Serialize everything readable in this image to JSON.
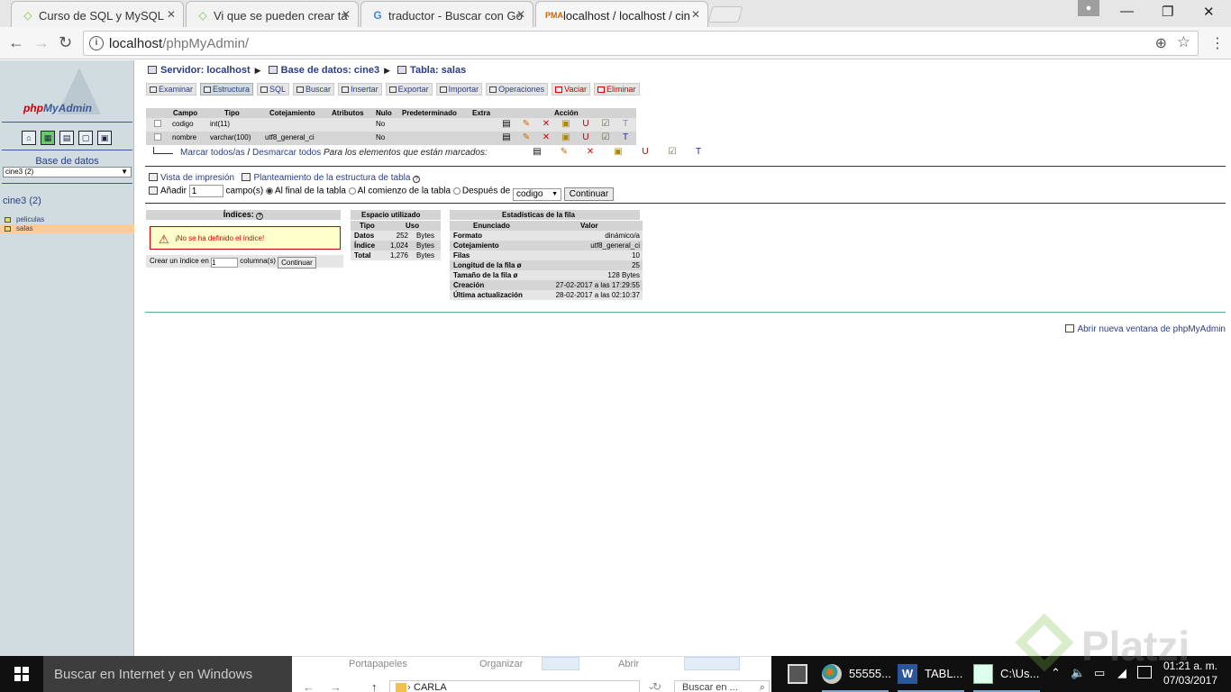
{
  "browser": {
    "tabs": [
      {
        "title": "Curso de SQL y MySQL",
        "icon": "platzi-icon",
        "active": false
      },
      {
        "title": "Vi que se pueden crear ta",
        "icon": "platzi-icon",
        "active": false
      },
      {
        "title": "traductor - Buscar con Go",
        "icon": "google-icon",
        "active": false
      },
      {
        "title": "localhost / localhost / cin",
        "icon": "pma-icon",
        "active": true
      }
    ],
    "url_host": "localhost",
    "url_path": "/phpMyAdmin/"
  },
  "sidebar": {
    "logo_php": "php",
    "logo_myadmin": "MyAdmin",
    "db_label": "Base de datos",
    "db_select": "cine3 (2)",
    "db_name": "cine3 (2)",
    "tables": [
      {
        "name": "peliculas",
        "selected": false
      },
      {
        "name": "salas",
        "selected": true
      }
    ]
  },
  "breadcrumb": {
    "server": "Servidor: localhost",
    "database": "Base de datos: cine3",
    "table": "Tabla: salas"
  },
  "tabs": [
    {
      "label": "Examinar",
      "active": false,
      "red": false
    },
    {
      "label": "Estructura",
      "active": true,
      "red": false
    },
    {
      "label": "SQL",
      "active": false,
      "red": false
    },
    {
      "label": "Buscar",
      "active": false,
      "red": false
    },
    {
      "label": "Insertar",
      "active": false,
      "red": false
    },
    {
      "label": "Exportar",
      "active": false,
      "red": false
    },
    {
      "label": "Importar",
      "active": false,
      "red": false
    },
    {
      "label": "Operaciones",
      "active": false,
      "red": false
    },
    {
      "label": "Vaciar",
      "active": false,
      "red": true
    },
    {
      "label": "Eliminar",
      "active": false,
      "red": true
    }
  ],
  "structure": {
    "headers": [
      "Campo",
      "Tipo",
      "Cotejamiento",
      "Atributos",
      "Nulo",
      "Predeterminado",
      "Extra",
      "Acción"
    ],
    "rows": [
      {
        "campo": "codigo",
        "tipo": "int(11)",
        "cotejamiento": "",
        "atributos": "",
        "nulo": "No",
        "predeterminado": "",
        "extra": ""
      },
      {
        "campo": "nombre",
        "tipo": "varchar(100)",
        "cotejamiento": "utf8_general_ci",
        "atributos": "",
        "nulo": "No",
        "predeterminado": "",
        "extra": ""
      }
    ],
    "mark_all": "Marcar todos/as",
    "separator": "/",
    "unmark_all": "Desmarcar todos",
    "for_marked": "Para los elementos que están marcados:"
  },
  "print_view": "Vista de impresión",
  "structure_plan": "Planteamiento de la estructura de tabla",
  "add": {
    "label": "Añadir",
    "count": "1",
    "fields": "campo(s)",
    "opt_end": "Al final de la tabla",
    "opt_start": "Al comienzo de la tabla",
    "opt_after": "Después de",
    "after_field": "codigo",
    "button": "Continuar"
  },
  "indices": {
    "title": "Índices:",
    "none_msg": "¡No se ha definido el índice!",
    "create_prefix": "Crear un índice en",
    "create_count": "1",
    "create_suffix": "columna(s)",
    "button": "Continuar"
  },
  "space": {
    "title": "Espacio utilizado",
    "col_type": "Tipo",
    "col_use": "Uso",
    "rows": [
      {
        "tipo": "Datos",
        "uso": "252",
        "unit": "Bytes"
      },
      {
        "tipo": "Índice",
        "uso": "1,024",
        "unit": "Bytes"
      },
      {
        "tipo": "Total",
        "uso": "1,276",
        "unit": "Bytes"
      }
    ]
  },
  "stats": {
    "title": "Estadísticas de la fila",
    "col_stmt": "Enunciado",
    "col_value": "Valor",
    "rows": [
      {
        "k": "Formato",
        "v": "dinámico/a"
      },
      {
        "k": "Cotejamiento",
        "v": "utf8_general_ci"
      },
      {
        "k": "Filas",
        "v": "10"
      },
      {
        "k": "Longitud de la fila ø",
        "v": "25"
      },
      {
        "k": "Tamaño de la fila ø",
        "v": "128 Bytes"
      },
      {
        "k": "Creación",
        "v": "27-02-2017 a las 17:29:55"
      },
      {
        "k": "Última actualización",
        "v": "28-02-2017 a las 02:10:37"
      }
    ]
  },
  "open_new_window": "Abrir nueva ventana de phpMyAdmin",
  "explorer": {
    "portapapeles": "Portapapeles",
    "organizar": "Organizar",
    "abrir": "Abrir",
    "path": "CARLA",
    "search": "Buscar en ..."
  },
  "taskbar": {
    "search_placeholder": "Buscar en Internet y en Windows",
    "apps": [
      {
        "label": "",
        "icon": "calculator-icon"
      },
      {
        "label": "55555...",
        "icon": "paint-icon"
      },
      {
        "label": "TABL...",
        "icon": "word-icon"
      },
      {
        "label": "C:\\Us...",
        "icon": "notepad-icon"
      }
    ],
    "time": "01:21 a. m.",
    "date": "07/03/2017"
  },
  "watermark": "Platzi"
}
